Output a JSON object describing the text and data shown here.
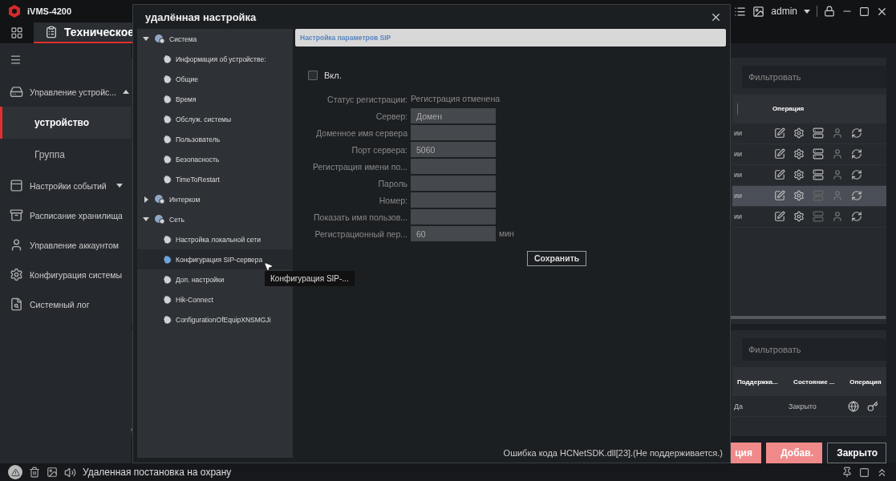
{
  "app": {
    "title": "iVMS-4200",
    "tab": {
      "label": "Техническое",
      "selected": true
    },
    "user": "admin"
  },
  "sidebar": {
    "items": [
      {
        "label": "Управление устройс...",
        "expanded": true,
        "children": [
          {
            "label": "устройство",
            "selected": true
          },
          {
            "label": "Группа",
            "selected": false
          }
        ]
      },
      {
        "label": "Настройки событий",
        "expanded": false
      },
      {
        "label": "Расписание хранилища"
      },
      {
        "label": "Управление аккаунтом"
      },
      {
        "label": "Конфигурация системы"
      },
      {
        "label": "Системный лог"
      }
    ]
  },
  "device_table": {
    "filter": {
      "placeholder": "Фильтровать"
    },
    "columns": [
      "Операция"
    ],
    "rows": [
      {
        "cell": "ии",
        "selected": false,
        "storage_active": true
      },
      {
        "cell": "ии",
        "selected": false,
        "storage_active": true
      },
      {
        "cell": "ии",
        "selected": false,
        "storage_active": true
      },
      {
        "cell": "ии",
        "selected": true,
        "storage_active": false
      },
      {
        "cell": "ии",
        "selected": false,
        "storage_active": false
      }
    ]
  },
  "resource_table": {
    "filter": {
      "placeholder": "Фильтровать"
    },
    "columns": [
      "Поддержка...",
      "Состояние ...",
      "Операция"
    ],
    "rows": [
      {
        "cells": [
          "Да",
          "Закрыто"
        ]
      }
    ]
  },
  "buttons": [
    {
      "label": "ция",
      "kind": "primary"
    },
    {
      "label": "Добав.",
      "kind": "primary"
    },
    {
      "label": "Закрыто",
      "kind": "secondary"
    }
  ],
  "status_bar": {
    "message": "Удаленная постановка на охрану"
  },
  "dialog": {
    "title": "удалённая настройка",
    "tree": [
      {
        "label": "Система",
        "expanded": true,
        "children": [
          {
            "label": "Информация об устройстве:",
            "selected": false
          },
          {
            "label": "Общие",
            "selected": false
          },
          {
            "label": "Время",
            "selected": false
          },
          {
            "label": "Обслуж. системы",
            "selected": false
          },
          {
            "label": "Пользователь",
            "selected": false
          },
          {
            "label": "Безопасность",
            "selected": false
          },
          {
            "label": "TimeToRestart",
            "selected": false
          }
        ]
      },
      {
        "label": "Интерком",
        "expanded": false
      },
      {
        "label": "Сеть",
        "expanded": true,
        "children": [
          {
            "label": "Настройка локальной сети",
            "selected": false
          },
          {
            "label": "Конфигурация SIP-сервера",
            "selected": true
          },
          {
            "label": "Доп. настройки",
            "selected": false
          },
          {
            "label": "Hik-Connect",
            "selected": false
          },
          {
            "label": "ConfigurationOfEquipXNSMGJi",
            "selected": false
          }
        ]
      }
    ],
    "panel": {
      "title": "Настройка параметров SIP",
      "enable": {
        "label": "Вкл.",
        "checked": false
      },
      "fields": [
        {
          "label": "Статус регистрации:",
          "kind": "text",
          "value": "Регистрация отменена"
        },
        {
          "label": "Сервер:",
          "kind": "input",
          "value": "Домен"
        },
        {
          "label": "Доменное имя сервера",
          "kind": "input"
        },
        {
          "label": "Порт сервера:",
          "kind": "input",
          "value": "5060"
        },
        {
          "label": "Регистрация имени по...",
          "kind": "input"
        },
        {
          "label": "Пароль",
          "kind": "input"
        },
        {
          "label": "Номер:",
          "kind": "input"
        },
        {
          "label": "Показать имя пользов...",
          "kind": "input"
        },
        {
          "label": "Регистрационный пер...",
          "kind": "input",
          "value": "60",
          "unit": "мин"
        }
      ],
      "save": "Сохранить"
    },
    "error": "Ошибка кода HCNetSDK.dll[23].(Не поддерживается.)",
    "tooltip": "Конфигурация SIP-..."
  }
}
